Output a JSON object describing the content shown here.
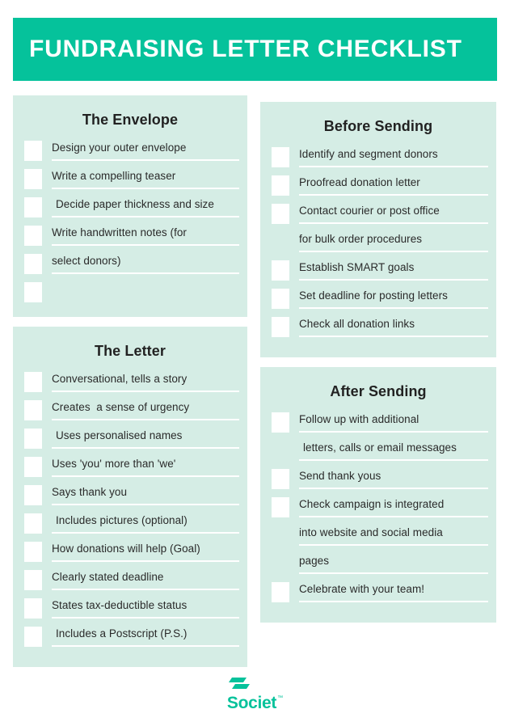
{
  "header": {
    "title": "FUNDRAISING LETTER CHECKLIST",
    "background_color": "#05C29B",
    "text_color": "#FFFFFF"
  },
  "theme": {
    "card_background": "#D5EDE5",
    "accent": "#05C29B",
    "checkbox_fill": "#FFFFFF",
    "rule_color": "#FFFFFF",
    "text_color": "#2A2A2A"
  },
  "left_column": {
    "cards": [
      {
        "title": "The Envelope",
        "items": [
          {
            "label": "Design your outer envelope",
            "checkbox": true,
            "indent": false
          },
          {
            "label": "Write a compelling teaser",
            "checkbox": true,
            "indent": false
          },
          {
            "label": "Decide paper thickness and size",
            "checkbox": true,
            "indent": true
          },
          {
            "label": "Write handwritten notes (for",
            "checkbox": true,
            "indent": false
          },
          {
            "label": "select donors)",
            "checkbox": true,
            "indent": false
          }
        ],
        "has_trailing_stub_checkbox": true
      },
      {
        "title": "The Letter",
        "items": [
          {
            "label": "Conversational, tells a story",
            "checkbox": true,
            "indent": false
          },
          {
            "label": "Creates  a sense of urgency",
            "checkbox": true,
            "indent": false
          },
          {
            "label": "Uses personalised names",
            "checkbox": true,
            "indent": true
          },
          {
            "label": "Uses 'you' more than 'we'",
            "checkbox": true,
            "indent": false
          },
          {
            "label": "Says thank you",
            "checkbox": true,
            "indent": false
          },
          {
            "label": "Includes pictures (optional)",
            "checkbox": true,
            "indent": true
          },
          {
            "label": "How donations will help (Goal)",
            "checkbox": true,
            "indent": false
          },
          {
            "label": "Clearly stated deadline",
            "checkbox": true,
            "indent": false
          },
          {
            "label": "States tax-deductible status",
            "checkbox": true,
            "indent": false
          },
          {
            "label": "Includes a Postscript (P.S.)",
            "checkbox": true,
            "indent": true
          }
        ],
        "has_trailing_stub_checkbox": false
      }
    ]
  },
  "right_column": {
    "cards": [
      {
        "title": "Before Sending",
        "items": [
          {
            "label": "Identify and segment donors",
            "checkbox": true,
            "indent": false
          },
          {
            "label": "Proofread donation letter",
            "checkbox": true,
            "indent": false
          },
          {
            "label": "Contact courier or post office",
            "checkbox": true,
            "indent": false
          },
          {
            "label": "for bulk order procedures",
            "checkbox": false,
            "indent": false
          },
          {
            "label": "Establish SMART goals",
            "checkbox": true,
            "indent": false
          },
          {
            "label": "Set deadline for posting letters",
            "checkbox": true,
            "indent": false
          },
          {
            "label": "Check all donation links",
            "checkbox": true,
            "indent": false
          }
        ],
        "has_trailing_stub_checkbox": false
      },
      {
        "title": "After Sending",
        "items": [
          {
            "label": "Follow up with additional",
            "checkbox": true,
            "indent": false
          },
          {
            "label": "letters, calls or email messages",
            "checkbox": false,
            "indent": true
          },
          {
            "label": "Send thank yous",
            "checkbox": true,
            "indent": false
          },
          {
            "label": "Check campaign is integrated",
            "checkbox": true,
            "indent": false
          },
          {
            "label": "into website and social media",
            "checkbox": false,
            "indent": false
          },
          {
            "label": "pages",
            "checkbox": false,
            "indent": false
          },
          {
            "label": "Celebrate with your team!",
            "checkbox": true,
            "indent": false
          }
        ],
        "has_trailing_stub_checkbox": false
      }
    ]
  },
  "footer": {
    "logo_text": "Societ",
    "logo_trademark": "™",
    "logo_color": "#05C29B"
  }
}
